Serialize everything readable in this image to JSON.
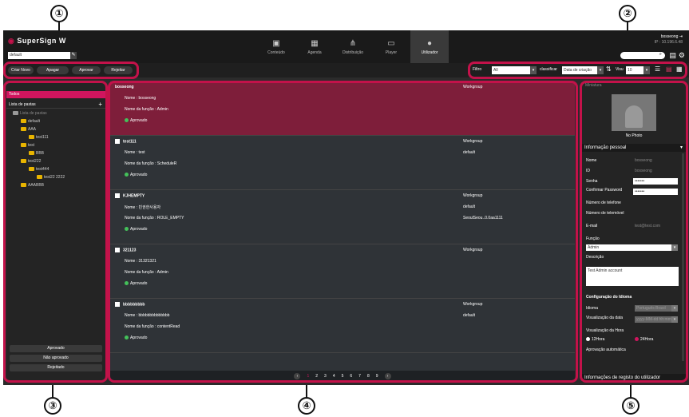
{
  "callouts": [
    "①",
    "②",
    "③",
    "④",
    "⑤"
  ],
  "logo": {
    "text": "SuperSign",
    "suffix": "W"
  },
  "account": {
    "value": "default"
  },
  "nav": [
    {
      "label": "Conteúdo",
      "icon": "content-icon"
    },
    {
      "label": "Agenda",
      "icon": "calendar-icon"
    },
    {
      "label": "Distribuição",
      "icon": "distribution-icon"
    },
    {
      "label": "Player",
      "icon": "player-icon"
    },
    {
      "label": "Utilizador",
      "icon": "user-icon"
    }
  ],
  "user": {
    "name": "bosseong",
    "ip": "IP : 10.196.6.48"
  },
  "toolbar": {
    "buttons": [
      "Criar Novo",
      "Apagar",
      "Aprovar",
      "Rejeitar"
    ],
    "filter_label": "Filtro",
    "filter_value": "All",
    "sort_label": "classificar",
    "sort_value": "Data de criação",
    "view_label": "Visu",
    "view_value": "10"
  },
  "sidebar": {
    "todos": "Todos",
    "list_head": "Lista de pastas",
    "tree": [
      {
        "label": "Lista de pastas",
        "level": 0,
        "grey": true
      },
      {
        "label": "default",
        "level": 1
      },
      {
        "label": "AAA",
        "level": 1
      },
      {
        "label": "test111",
        "level": 2
      },
      {
        "label": "test",
        "level": 1
      },
      {
        "label": "BBB",
        "level": 2
      },
      {
        "label": "test222",
        "level": 1
      },
      {
        "label": "test444",
        "level": 2
      },
      {
        "label": "test22 2222",
        "level": 3
      },
      {
        "label": "AAABBB",
        "level": 1
      }
    ],
    "buttons": [
      "Aprovado",
      "Não aprovado",
      "Rejeitado"
    ]
  },
  "users": [
    {
      "id": "bosseong",
      "name": "Nome : bosseong",
      "role": "Nome da função : Admin",
      "status": "Aprovado",
      "group_label": "Workgroup",
      "group_value": "",
      "selected": true
    },
    {
      "id": "test111",
      "name": "Nome : test",
      "role": "Nome da função : ScheduleR",
      "status": "Aprovado",
      "group_label": "Workgroup",
      "group_value": "default",
      "selected": false
    },
    {
      "id": "KJHEMPTY",
      "name": "Nome : 빈권한사용자",
      "role": "Nome da função : ROLE_EMPTY",
      "status": "Aprovado",
      "group_label": "Workgroup",
      "group_value": "default",
      "group_value2": "SeoulSeou..0.0aa1111",
      "selected": false
    },
    {
      "id": "321123",
      "name": "Nome : 31321321",
      "role": "Nome da função : Admin",
      "status": "Aprovado",
      "group_label": "Workgroup",
      "group_value": "",
      "selected": false
    },
    {
      "id": "bbbbbbbbb",
      "name": "Nome : bbbbbbbbbbbbbb",
      "role": "Nome da função : contentRead",
      "status": "Aprovado",
      "group_label": "Workgroup",
      "group_value": "default",
      "selected": false
    }
  ],
  "pagination": {
    "pages": [
      "1",
      "2",
      "3",
      "4",
      "5",
      "6",
      "7",
      "8",
      "9"
    ],
    "current": "1"
  },
  "panel": {
    "header": "Miniatura",
    "no_photo": "No Photo",
    "info_head": "Informação pessoal",
    "fields": [
      {
        "label": "Nome",
        "value": "bosseong"
      },
      {
        "label": "ID",
        "value": "bosseong"
      }
    ],
    "senha_label": "Senha",
    "senha_value": "•••••••",
    "confirm_label": "Confirmar Password",
    "confirm_value": "•••••••",
    "tel_label": "Número de telefone",
    "mob_label": "Número de telemóvel",
    "email_label": "E-mail",
    "email_value": "test@test.com",
    "funcao_label": "Função",
    "funcao_value": "Admin",
    "desc_label": "Descrição",
    "desc_value": "Test Admin account",
    "lang_head": "Configuração do Idioma",
    "idioma_label": "Idioma",
    "idioma_value": "Português Brasil",
    "vis_data_label": "Visualização da data",
    "vis_data_value": "yyyy-MM-dd hh:mm",
    "vis_hora_label": "Visualização da Hora",
    "hora_12": "12Hora",
    "hora_24": "24Hora",
    "aprov_label": "Aprovação automática",
    "reg_footer": "Informações de registo do utilizador"
  }
}
